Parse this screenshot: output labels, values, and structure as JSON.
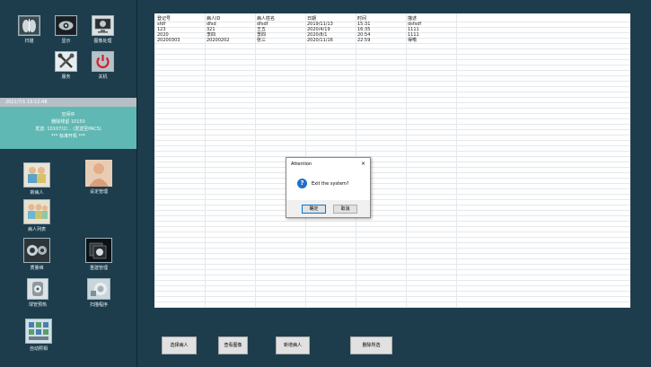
{
  "sidebar": {
    "top_buttons": [
      {
        "label": "扫描",
        "icon": "lungs-xray-icon"
      },
      {
        "label": "显示",
        "icon": "eye-icon"
      },
      {
        "label": "图像处理",
        "icon": "monitor-icon"
      },
      {
        "label": "服务",
        "icon": "tools-icon"
      },
      {
        "label": "关机",
        "icon": "power-icon"
      }
    ],
    "status": {
      "datetime": "2021/7/1 15:12:48",
      "lines": [
        "空闲中",
        "删除残留 10150",
        "发送: 10107/2/... (发送至PACS)",
        "*** 标准开机 ***"
      ]
    },
    "lower_buttons": [
      {
        "label": "新病人",
        "icon": "new-patient-icon"
      },
      {
        "label": "设定管理",
        "icon": "settings-manage-icon"
      },
      {
        "label": "病人列表",
        "icon": "patient-list-icon"
      },
      {
        "label": "质量维",
        "icon": "quality-icon"
      },
      {
        "label": "重建管理",
        "icon": "reconstruction-icon"
      },
      {
        "label": "球管预热",
        "icon": "tube-warmup-icon"
      },
      {
        "label": "扫描程序",
        "icon": "scan-program-icon"
      },
      {
        "label": "自动照相",
        "icon": "auto-photo-icon"
      }
    ]
  },
  "table": {
    "columns": [
      "登记号",
      "病人ID",
      "病人姓名",
      "日期",
      "时间",
      "描述"
    ],
    "rows": [
      [
        "sfdf",
        "dfsd",
        "dfsdf",
        "2019/11/13",
        "15:31",
        "dsfsdf"
      ],
      [
        "123",
        "321",
        "王五",
        "2020/4/19",
        "16:35",
        "1111"
      ],
      [
        "2020",
        "李四",
        "李四",
        "2020/8/1",
        "20:54",
        "1111"
      ],
      [
        "20200303",
        "20200202",
        "张三",
        "2020/11/16",
        "22:59",
        "得嘞"
      ]
    ]
  },
  "dialog": {
    "title": "Attention",
    "close": "×",
    "message": "Exit the system?",
    "ok_label": "确定",
    "cancel_label": "取消"
  },
  "actions": {
    "select_patient": "选择病人",
    "view_images": "查看图像",
    "new_patient": "新增病人",
    "delete_selected": "删除所选"
  }
}
